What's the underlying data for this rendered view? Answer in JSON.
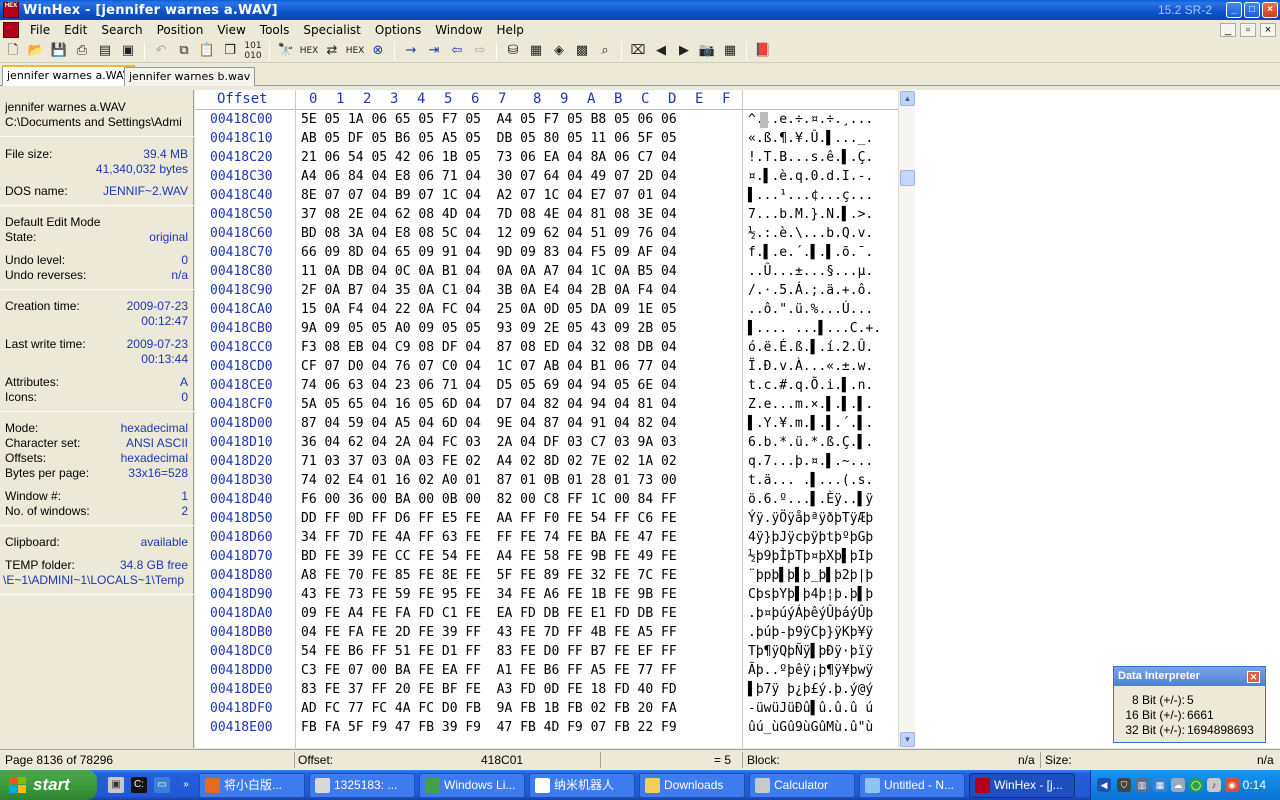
{
  "window": {
    "title": "WinHex - [jennifer warnes a.WAV]",
    "version": "15.2 SR-2",
    "app_icon_text": "HEX",
    "caption_buttons": [
      "_",
      "□",
      "×"
    ]
  },
  "menu": {
    "items": [
      "File",
      "Edit",
      "Search",
      "Position",
      "View",
      "Tools",
      "Specialist",
      "Options",
      "Window",
      "Help"
    ],
    "mdi_buttons": [
      "_",
      "▫",
      "×"
    ]
  },
  "toolbar": {
    "buttons": [
      "new-icon",
      "open-icon",
      "save-icon",
      "print-icon",
      "properties-icon",
      "open-disk-icon",
      "undo-icon",
      "copy-icon",
      "paste-icon",
      "clipboard-icon",
      "binary-icon",
      "find-icon",
      "find-hex-icon",
      "replace-icon",
      "replace-hex-icon",
      "find-next-icon",
      "goto-offset-icon",
      "goto-icon",
      "back-icon",
      "forward-icon",
      "disk-icon",
      "ram-icon",
      "disk-clone-icon",
      "calculator-icon",
      "search-icon",
      "media-icon",
      "prev-icon",
      "next-icon",
      "camera-icon",
      "table-icon",
      "help-icon"
    ]
  },
  "tabs": [
    "jennifer warnes a.WAV",
    "jennifer warnes b.wav"
  ],
  "info": {
    "filename": "jennifer warnes a.WAV",
    "path": "C:\\Documents and Settings\\Admi",
    "file_size_label": "File size:",
    "file_size_mb": "39.4 MB",
    "file_size_bytes": "41,340,032 bytes",
    "dos_name_label": "DOS name:",
    "dos_name": "JENNIF~2.WAV",
    "edit_mode_label": "Default Edit Mode",
    "state_label": "State:",
    "state": "original",
    "undo_level_label": "Undo level:",
    "undo_level": "0",
    "undo_reverses_label": "Undo reverses:",
    "undo_reverses": "n/a",
    "creation_label": "Creation time:",
    "creation_date": "2009-07-23",
    "creation_time": "00:12:47",
    "lastwrite_label": "Last write time:",
    "lastwrite_date": "2009-07-23",
    "lastwrite_time": "00:13:44",
    "attributes_label": "Attributes:",
    "attributes": "A",
    "icons_label": "Icons:",
    "icons": "0",
    "mode_label": "Mode:",
    "mode": "hexadecimal",
    "charset_label": "Character set:",
    "charset": "ANSI ASCII",
    "offsets_label": "Offsets:",
    "offsets": "hexadecimal",
    "bpp_label": "Bytes per page:",
    "bpp": "33x16=528",
    "window_label": "Window #:",
    "window_num": "1",
    "nwindows_label": "No. of windows:",
    "nwindows": "2",
    "clipboard_label": "Clipboard:",
    "clipboard": "available",
    "temp_label": "TEMP folder:",
    "temp_free": "34.8 GB free",
    "temp_path": "\\E~1\\ADMINI~1\\LOCALS~1\\Temp"
  },
  "hex": {
    "offset_header": "Offset",
    "col_headers": [
      "0",
      "1",
      "2",
      "3",
      "4",
      "5",
      "6",
      "7",
      "8",
      "9",
      "A",
      "B",
      "C",
      "D",
      "E",
      "F"
    ],
    "rows": [
      {
        "offset": "00418C00",
        "bytes": "5E 05 1A 06 65 05 F7 05  A4 05 F7 05 B8 05 06 06",
        "text": "^...e.÷.¤.÷.¸..."
      },
      {
        "offset": "00418C10",
        "bytes": "AB 05 DF 05 B6 05 A5 05  DB 05 80 05 11 06 5F 05",
        "text": "«.ß.¶.¥.Û.▌..._."
      },
      {
        "offset": "00418C20",
        "bytes": "21 06 54 05 42 06 1B 05  73 06 EA 04 8A 06 C7 04",
        "text": "!.T.B...s.ê.▌.Ç."
      },
      {
        "offset": "00418C30",
        "bytes": "A4 06 84 04 E8 06 71 04  30 07 64 04 49 07 2D 04",
        "text": "¤.▌.è.q.0.d.I.-."
      },
      {
        "offset": "00418C40",
        "bytes": "8E 07 07 04 B9 07 1C 04  A2 07 1C 04 E7 07 01 04",
        "text": "▌...¹...¢...ç..."
      },
      {
        "offset": "00418C50",
        "bytes": "37 08 2E 04 62 08 4D 04  7D 08 4E 04 81 08 3E 04",
        "text": "7...b.M.}.N.▌.>."
      },
      {
        "offset": "00418C60",
        "bytes": "BD 08 3A 04 E8 08 5C 04  12 09 62 04 51 09 76 04",
        "text": "½.:.è.\\...b.Q.v."
      },
      {
        "offset": "00418C70",
        "bytes": "66 09 8D 04 65 09 91 04  9D 09 83 04 F5 09 AF 04",
        "text": "f.▌.e.´.▌.▌.õ.¯."
      },
      {
        "offset": "00418C80",
        "bytes": "11 0A DB 04 0C 0A B1 04  0A 0A A7 04 1C 0A B5 04",
        "text": "..Û...±...§...µ."
      },
      {
        "offset": "00418C90",
        "bytes": "2F 0A B7 04 35 0A C1 04  3B 0A E4 04 2B 0A F4 04",
        "text": "/.·.5.Á.;.ä.+.ô."
      },
      {
        "offset": "00418CA0",
        "bytes": "15 0A F4 04 22 0A FC 04  25 0A 0D 05 DA 09 1E 05",
        "text": "..ô.\".ü.%...Ú..."
      },
      {
        "offset": "00418CB0",
        "bytes": "9A 09 05 05 A0 09 05 05  93 09 2E 05 43 09 2B 05",
        "text": "▌.... ...▌...C.+."
      },
      {
        "offset": "00418CC0",
        "bytes": "F3 08 EB 04 C9 08 DF 04  87 08 ED 04 32 08 DB 04",
        "text": "ó.ë.É.ß.▌.í.2.Û."
      },
      {
        "offset": "00418CD0",
        "bytes": "CF 07 D0 04 76 07 C0 04  1C 07 AB 04 B1 06 77 04",
        "text": "Ï.Ð.v.À...«.±.w."
      },
      {
        "offset": "00418CE0",
        "bytes": "74 06 63 04 23 06 71 04  D5 05 69 04 94 05 6E 04",
        "text": "t.c.#.q.Õ.i.▌.n."
      },
      {
        "offset": "00418CF0",
        "bytes": "5A 05 65 04 16 05 6D 04  D7 04 82 04 94 04 81 04",
        "text": "Z.e...m.×.▌.▌.▌."
      },
      {
        "offset": "00418D00",
        "bytes": "87 04 59 04 A5 04 6D 04  9E 04 87 04 91 04 82 04",
        "text": "▌.Y.¥.m.▌.▌.´.▌."
      },
      {
        "offset": "00418D10",
        "bytes": "36 04 62 04 2A 04 FC 03  2A 04 DF 03 C7 03 9A 03",
        "text": "6.b.*.ü.*.ß.Ç.▌."
      },
      {
        "offset": "00418D20",
        "bytes": "71 03 37 03 0A 03 FE 02  A4 02 8D 02 7E 02 1A 02",
        "text": "q.7...þ.¤.▌.~..."
      },
      {
        "offset": "00418D30",
        "bytes": "74 02 E4 01 16 02 A0 01  87 01 0B 01 28 01 73 00",
        "text": "t.ä... .▌...(.s."
      },
      {
        "offset": "00418D40",
        "bytes": "F6 00 36 00 BA 00 0B 00  82 00 C8 FF 1C 00 84 FF",
        "text": "ö.6.º...▌.Èÿ..▌ÿ"
      },
      {
        "offset": "00418D50",
        "bytes": "DD FF 0D FF D6 FF E5 FE  AA FF F0 FE 54 FF C6 FE",
        "text": "Ýÿ.ÿÖÿåþªÿðþTÿÆþ"
      },
      {
        "offset": "00418D60",
        "bytes": "34 FF 7D FE 4A FF 63 FE  FF FE 74 FE BA FE 47 FE",
        "text": "4ÿ}þJÿcþÿþtþºþGþ"
      },
      {
        "offset": "00418D70",
        "bytes": "BD FE 39 FE CC FE 54 FE  A4 FE 58 FE 9B FE 49 FE",
        "text": "½þ9þÌþTþ¤þXþ▌þIþ"
      },
      {
        "offset": "00418D80",
        "bytes": "A8 FE 70 FE 85 FE 8E FE  5F FE 89 FE 32 FE 7C FE",
        "text": "¨þpþ▌þ▌þ_þ▌þ2þ|þ"
      },
      {
        "offset": "00418D90",
        "bytes": "43 FE 73 FE 59 FE 95 FE  34 FE A6 FE 1B FE 9B FE",
        "text": "CþsþYþ▌þ4þ¦þ.þ▌þ"
      },
      {
        "offset": "00418DA0",
        "bytes": "09 FE A4 FE FA FD C1 FE  EA FD DB FE E1 FD DB FE",
        "text": ".þ¤þúýÁþêýÛþáýÛþ"
      },
      {
        "offset": "00418DB0",
        "bytes": "04 FE FA FE 2D FE 39 FF  43 FE 7D FF 4B FE A5 FF",
        "text": ".þúþ-þ9ÿCþ}ÿKþ¥ÿ"
      },
      {
        "offset": "00418DC0",
        "bytes": "54 FE B6 FF 51 FE D1 FF  83 FE D0 FF B7 FE EF FF",
        "text": "Tþ¶ÿQþÑÿ▌þÐÿ·þïÿ"
      },
      {
        "offset": "00418DD0",
        "bytes": "C3 FE 07 00 BA FE EA FF  A1 FE B6 FF A5 FE 77 FF",
        "text": "Ãþ..ºþêÿ¡þ¶ÿ¥þwÿ"
      },
      {
        "offset": "00418DE0",
        "bytes": "83 FE 37 FF 20 FE BF FE  A3 FD 0D FE 18 FD 40 FD",
        "text": "▌þ7ÿ þ¿þ£ý.þ.ý@ý"
      },
      {
        "offset": "00418DF0",
        "bytes": "AD FC 77 FC 4A FC D0 FB  9A FB 1B FB 02 FB 20 FA",
        "text": "-üwüJüÐû▌û.û.û ú"
      },
      {
        "offset": "00418E00",
        "bytes": "FB FA 5F F9 47 FB 39 F9  47 FB 4D F9 07 FB 22 F9",
        "text": "ûú_ùGû9ùGûMù.û\"ù"
      }
    ]
  },
  "interpreter": {
    "title": "Data Interpreter",
    "rows": [
      {
        "label": "8 Bit (+/-):",
        "value": "5"
      },
      {
        "label": "16 Bit (+/-):",
        "value": "6661"
      },
      {
        "label": "32 Bit (+/-):",
        "value": "1694898693"
      }
    ]
  },
  "status": {
    "page": "Page 8136 of 78296",
    "offset_label": "Offset:",
    "offset_value": "418C01",
    "equals": "= 5",
    "block_label": "Block:",
    "block_value": "n/a",
    "size_label": "Size:",
    "size_value": "n/a"
  },
  "taskbar": {
    "start_label": "start",
    "items": [
      {
        "label": "将小白版...",
        "icon": "firefox-icon",
        "color": "#e66a1f"
      },
      {
        "label": "1325183: ...",
        "icon": "window-icon",
        "color": "#d9d9d9"
      },
      {
        "label": "Windows Li...",
        "icon": "messenger-icon",
        "color": "#45a046"
      },
      {
        "label": "纳米机器人",
        "icon": "person-icon",
        "color": "#ffffff"
      },
      {
        "label": "Downloads",
        "icon": "folder-icon",
        "color": "#f3cf5a"
      },
      {
        "label": "Calculator",
        "icon": "calculator-icon",
        "color": "#c9c9c9"
      },
      {
        "label": "Untitled - N...",
        "icon": "notepad-icon",
        "color": "#8fc3f2"
      },
      {
        "label": "WinHex - [j...",
        "icon": "winhex-icon",
        "color": "#b3001b"
      }
    ],
    "clock": "0:14"
  }
}
